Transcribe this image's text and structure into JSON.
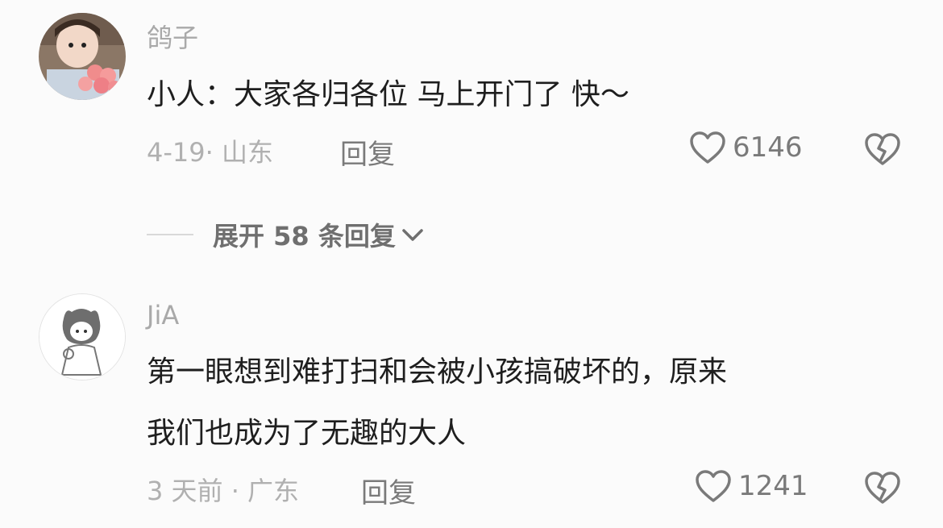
{
  "comments": [
    {
      "username": "鸽子",
      "text": "小人：大家各归各位 马上开门了 快～",
      "meta": "4-19· 山东",
      "reply_label": "回复",
      "likes": "6146",
      "avatar_icon": "girl-with-roses-avatar"
    },
    {
      "username": "JiA",
      "text_line1": "第一眼想到难打扫和会被小孩搞破坏的，原来",
      "text_line2": "我们也成为了无趣的大人",
      "meta": "3 天前 · 广东",
      "reply_label": "回复",
      "likes": "1241",
      "avatar_icon": "sketch-girl-avatar"
    }
  ],
  "expand_replies": {
    "label": "展开 58 条回复"
  },
  "colors": {
    "background": "#fbfbfb",
    "muted": "#a9a9a9",
    "text": "#1e1e1e"
  }
}
